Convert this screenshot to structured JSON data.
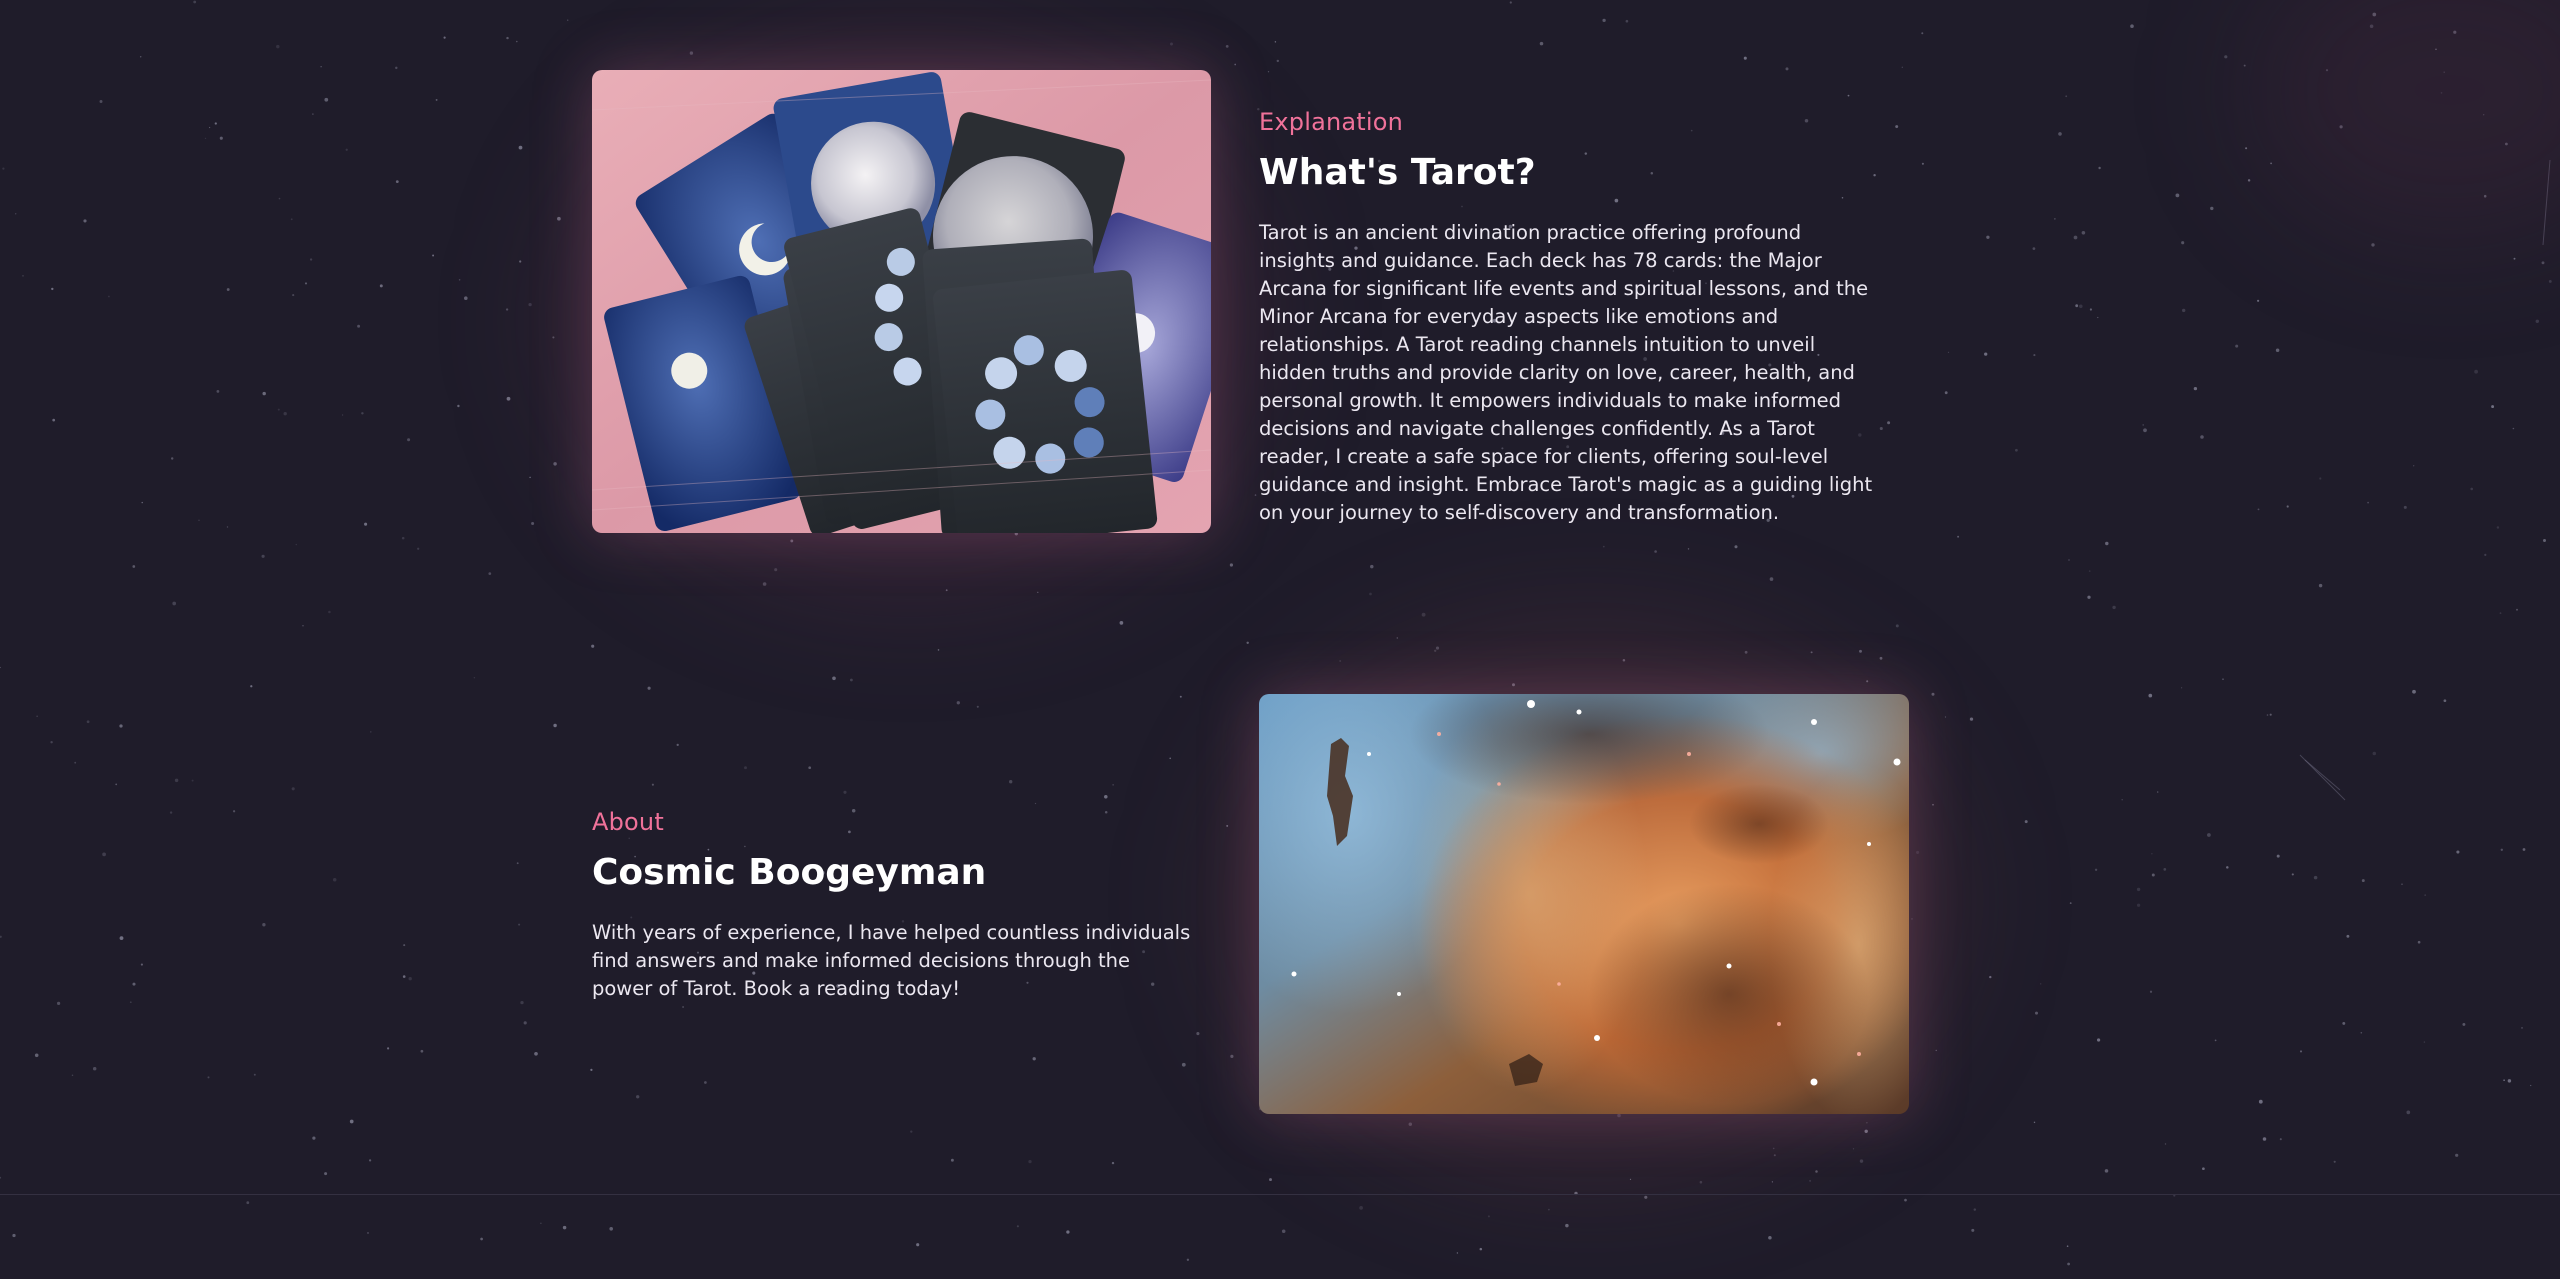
{
  "sections": {
    "explanation": {
      "eyebrow": "Explanation",
      "title": "What's Tarot?",
      "body": "Tarot is an ancient divination practice offering profound insights and guidance. Each deck has 78 cards: the Major Arcana for significant life events and spiritual lessons, and the Minor Arcana for everyday aspects like emotions and relationships. A Tarot reading channels intuition to unveil hidden truths and provide clarity on love, career, health, and personal growth. It empowers individuals to make informed decisions and navigate challenges confidently. As a Tarot reader, I create a safe space for clients, offering soul-level guidance and insight. Embrace Tarot's magic as a guiding light on your journey to self-discovery and transformation.",
      "image_icon": "tarot-cards-photo"
    },
    "about": {
      "eyebrow": "About",
      "title": "Cosmic Boogeyman",
      "body": "With years of experience, I have helped countless individuals find answers and make informed decisions through the power of Tarot. Book a reading today!",
      "image_icon": "nebula-photo"
    }
  },
  "colors": {
    "background": "#1f1c2a",
    "accent": "#f0729a",
    "heading": "#ffffff",
    "text": "#ebe7f0"
  }
}
